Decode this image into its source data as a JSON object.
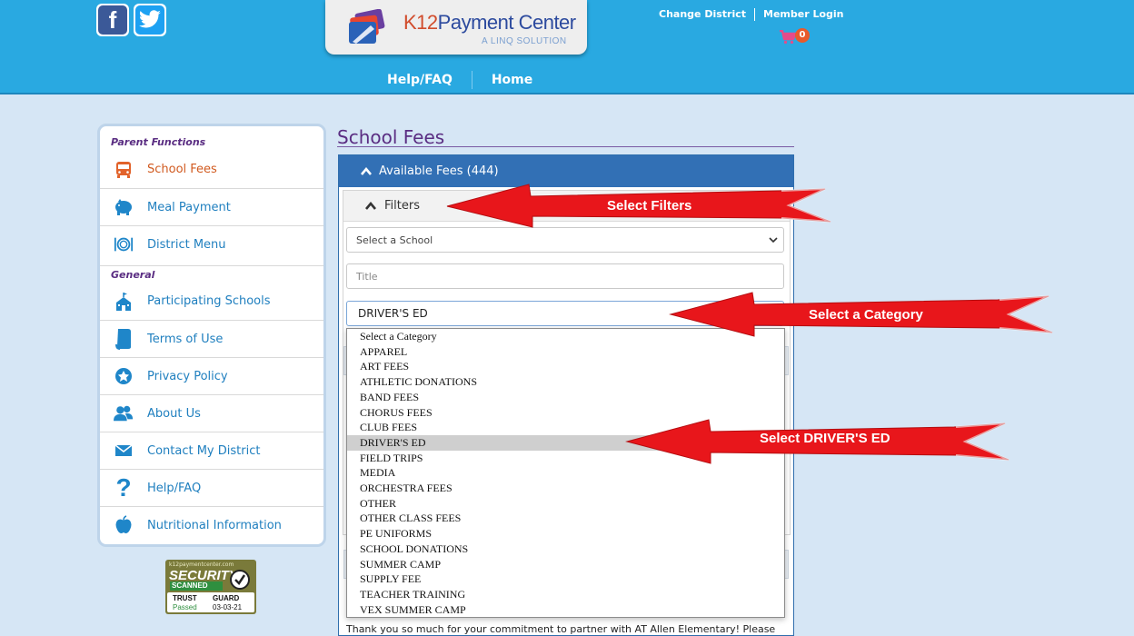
{
  "header": {
    "brand_k12": "K12",
    "brand_rest": "Payment Center",
    "brand_sub": "A LINQ SOLUTION",
    "change_district": "Change District",
    "member_login": "Member Login",
    "cart_count": "0",
    "nav": [
      {
        "label": "Help/FAQ"
      },
      {
        "label": "Home"
      }
    ],
    "social": [
      {
        "label": "f",
        "icon": "facebook-icon"
      },
      {
        "icon": "twitter-icon"
      }
    ]
  },
  "sidebar": {
    "parent_title": "Parent Functions",
    "general_title": "General",
    "parent_items": [
      {
        "label": "School Fees",
        "icon": "school-bus-icon",
        "active": true
      },
      {
        "label": "Meal Payment",
        "icon": "piggy-bank-icon"
      },
      {
        "label": "District Menu",
        "icon": "plate-utensils-icon"
      }
    ],
    "general_items": [
      {
        "label": "Participating Schools",
        "icon": "school-building-icon"
      },
      {
        "label": "Terms of Use",
        "icon": "scroll-icon"
      },
      {
        "label": "Privacy Policy",
        "icon": "badge-icon"
      },
      {
        "label": "About Us",
        "icon": "people-icon"
      },
      {
        "label": "Contact My District",
        "icon": "envelope-icon"
      },
      {
        "label": "Help/FAQ",
        "icon": "question-mark-icon"
      },
      {
        "label": "Nutritional Information",
        "icon": "apple-icon"
      }
    ],
    "trust_badge": {
      "domain": "k12paymentcenter.com",
      "line1": "SECURITY",
      "line2": "SCANNED",
      "trust": "TRUST",
      "guard": "GUARD",
      "passed": "Passed",
      "date": "03-03-21"
    }
  },
  "main": {
    "page_title": "School Fees",
    "panel_title": "Available Fees (444)",
    "filters_title": "Filters",
    "school_select": "Select a School",
    "title_placeholder": "Title",
    "category_value": "DRIVER'S ED",
    "category_options": [
      "Select a Category",
      "APPAREL",
      "ART FEES",
      "ATHLETIC DONATIONS",
      "BAND FEES",
      "CHORUS FEES",
      "CLUB FEES",
      "DRIVER'S ED",
      "FIELD TRIPS",
      "MEDIA",
      "ORCHESTRA FEES",
      "OTHER",
      "OTHER CLASS FEES",
      "PE UNIFORMS",
      "SCHOOL DONATIONS",
      "SUMMER CAMP",
      "SUPPLY FEE",
      "TEACHER TRAINING",
      "VEX SUMMER CAMP"
    ],
    "selected_option_index": 7,
    "thanks_text": "Thank you so much for your commitment to partner with AT Allen Elementary! Please"
  },
  "annotations": {
    "arrow1": "Select Filters",
    "arrow2": "Select a Category",
    "arrow3": "Select DRIVER'S ED",
    "arrow_color": "#e8161b"
  }
}
